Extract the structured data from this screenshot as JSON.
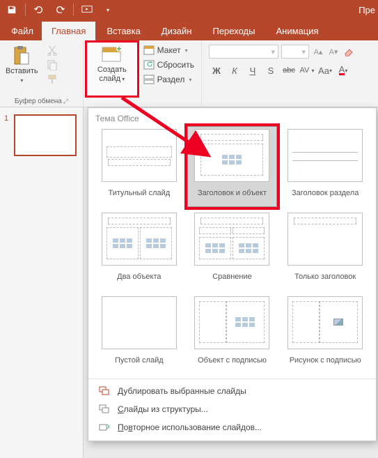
{
  "titlebar": {
    "title": "Пре"
  },
  "tabs": {
    "file": "Файл",
    "home": "Главная",
    "insert": "Вставка",
    "design": "Дизайн",
    "transitions": "Переходы",
    "animations": "Анимация"
  },
  "ribbon": {
    "clipboard": {
      "paste": "Вставить",
      "group_label": "Буфер обмена"
    },
    "slides": {
      "new_slide": "Создать слайд",
      "layout": "Макет",
      "reset": "Сбросить",
      "section": "Раздел"
    },
    "font": {
      "bold": "Ж",
      "italic": "К",
      "underline": "Ч",
      "shadow": "S",
      "strike": "abc",
      "spacing": "AV",
      "case": "Aa",
      "fontcolor": "A"
    }
  },
  "gallery": {
    "header": "Тема Office",
    "layouts": [
      {
        "id": "title",
        "label": "Титульный слайд"
      },
      {
        "id": "title-content",
        "label": "Заголовок и объект"
      },
      {
        "id": "section",
        "label": "Заголовок раздела"
      },
      {
        "id": "two-content",
        "label": "Два объекта"
      },
      {
        "id": "comparison",
        "label": "Сравнение"
      },
      {
        "id": "title-only",
        "label": "Только заголовок"
      },
      {
        "id": "blank",
        "label": "Пустой слайд"
      },
      {
        "id": "content-caption",
        "label": "Объект с подписью"
      },
      {
        "id": "picture-caption",
        "label": "Рисунок с подписью"
      }
    ],
    "menu": {
      "duplicate": "Дублировать выбранные слайды",
      "outline": "Слайды из структуры...",
      "reuse": "Повторное использование слайдов..."
    }
  },
  "thumb": {
    "num": "1"
  }
}
